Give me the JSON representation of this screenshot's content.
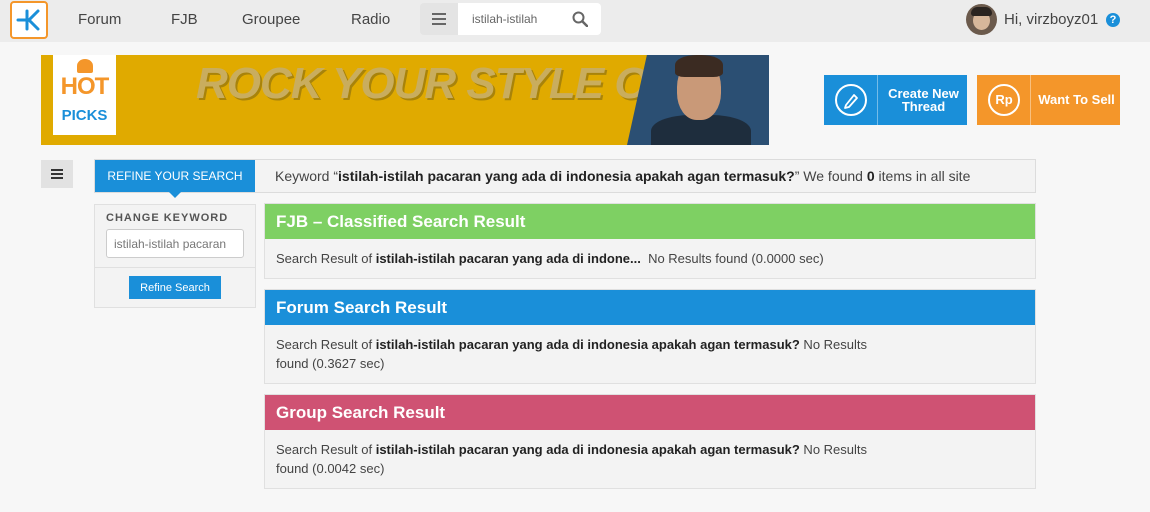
{
  "nav": {
    "links": [
      "Forum",
      "FJB",
      "Groupee",
      "Radio"
    ],
    "search_value": "istilah-istilah",
    "greeting": "Hi, virzboyz01",
    "help_glyph": "?"
  },
  "banner": {
    "badge_top": "HOT",
    "badge_bottom": "PICKS",
    "title": "ROCK YOUR STYLE OUT"
  },
  "actions": {
    "create_label": "Create New\nThread",
    "sell_label": "Want To Sell",
    "sell_icon_text": "Rp"
  },
  "keyword_bar": {
    "tab_label": "REFINE YOUR SEARCH",
    "prefix": "Keyword “",
    "keyword": "istilah-istilah pacaran yang ada di indonesia apakah agan termasuk?",
    "mid": "” We found ",
    "count": "0",
    "suffix": " items in all site"
  },
  "refine": {
    "label": "CHANGE KEYWORD",
    "input_value": "istilah-istilah pacaran",
    "button": "Refine Search"
  },
  "results": [
    {
      "title": "FJB – Classified Search Result",
      "color": "#7ed063",
      "prefix": "Search Result of ",
      "keyword": "istilah-istilah pacaran yang ada di indone...",
      "status": "  No Results found (0.0000 sec)"
    },
    {
      "title": "Forum Search Result",
      "color": "#1a8fd9",
      "prefix": "Search Result of ",
      "keyword": "istilah-istilah pacaran yang ada di indonesia apakah agan termasuk?",
      "status": " No Results found (0.3627 sec)"
    },
    {
      "title": "Group Search Result",
      "color": "#cf5273",
      "prefix": "Search Result of ",
      "keyword": "istilah-istilah pacaran yang ada di indonesia apakah agan termasuk?",
      "status": " No Results found (0.0042 sec)"
    }
  ],
  "colors": {
    "brand_orange": "#f4962a",
    "brand_blue": "#1a8fd9"
  }
}
